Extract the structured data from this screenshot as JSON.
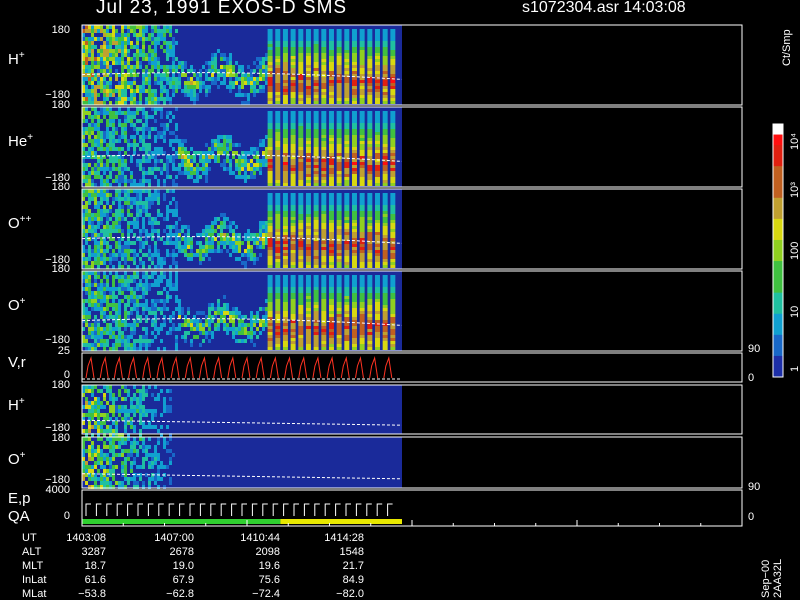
{
  "header": {
    "title_left": "Jul 23, 1991   EXOS-D SMS",
    "title_right": "s1072304.asr  14:03:08"
  },
  "colors": {
    "background": "#000000",
    "axis": "#ffffff",
    "fill_blue": "#1a2a9a",
    "reference_line": "#ffffff",
    "vr_trace": "#ff3322",
    "qa_green": "#30d030",
    "qa_yellow": "#e8e800"
  },
  "colorbar": {
    "label": "Ct/Smp",
    "ticks": [
      "10⁴",
      "10³",
      "100",
      "10",
      "1"
    ]
  },
  "chart_data": {
    "type": "heatmap",
    "panels": [
      {
        "label": "H",
        "sup": "+",
        "ymax": "180",
        "ymin": "−180"
      },
      {
        "label": "He",
        "sup": "+",
        "ymax": "180",
        "ymin": "−180"
      },
      {
        "label": "O",
        "sup": "++",
        "ymax": "180",
        "ymin": "−180"
      },
      {
        "label": "O",
        "sup": "+",
        "ymax": "180",
        "ymin": "−180",
        "right_tick": "90"
      },
      {
        "label": "V,r",
        "sup": "",
        "ymax": "25",
        "ymin": "0",
        "right_tick": "0"
      },
      {
        "label": "H",
        "sup": "+",
        "ymax": "180",
        "ymin": "−180"
      },
      {
        "label": "O",
        "sup": "+",
        "ymax": "180",
        "ymin": "−180",
        "right_tick": "90"
      },
      {
        "label": "E,p",
        "sup": "",
        "ymax": "4000",
        "ymin": "0",
        "right_tick": "0",
        "sub_label": "QA"
      }
    ],
    "bursts": 17,
    "burst_start_fraction": 0.58,
    "data_end_fraction": 0.5,
    "ephemeris": {
      "labels": [
        "UT",
        "ALT",
        "MLT",
        "InLat",
        "MLat"
      ],
      "columns": [
        [
          "1403:08",
          "3287",
          "18.7",
          "61.6",
          "−53.8"
        ],
        [
          "1407:00",
          "2678",
          "19.0",
          "67.9",
          "−62.8"
        ],
        [
          "1410:44",
          "2098",
          "19.6",
          "75.6",
          "−72.4"
        ],
        [
          "1414:28",
          "1548",
          "21.7",
          "84.9",
          "−82.0"
        ]
      ]
    }
  },
  "footer": {
    "stamp": "Sep−00 2AA32L"
  }
}
